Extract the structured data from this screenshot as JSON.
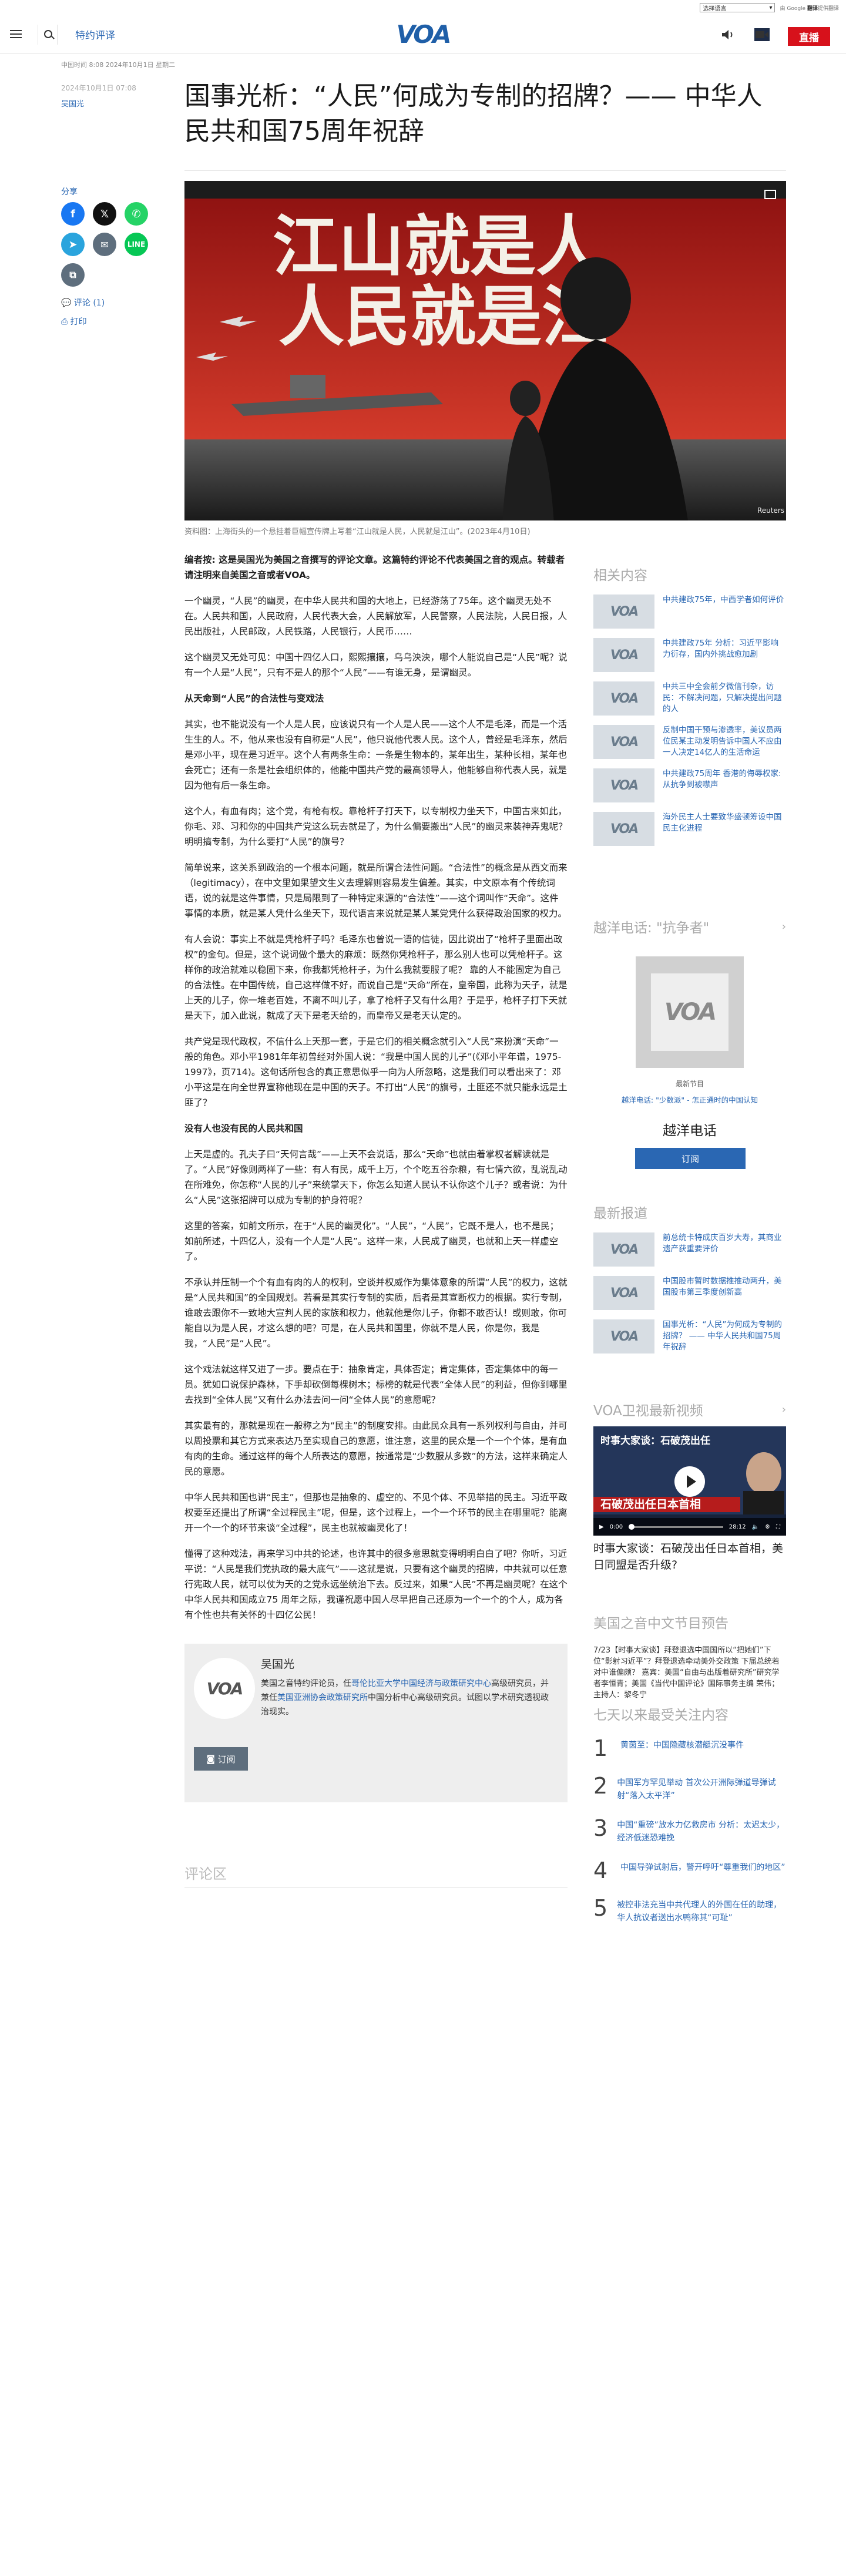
{
  "util": {
    "language_select": "选择语言",
    "powered": "由 Google",
    "translate_label": "翻译",
    "translate_extra": "提供翻译"
  },
  "header": {
    "section": "特约评译",
    "logo": "VOA",
    "live": "直播"
  },
  "article": {
    "dateline": "中国时间 8:08 2024年10月1日 星期二",
    "date": "2024年10月1日 07:08",
    "author": "吴国光",
    "title": "国事光析：“人民”何成为专制的招牌？—— 中华人民共和国75周年祝辞",
    "hero_banner_1": "江山就是人",
    "hero_banner_2": "人民就是江",
    "hero_credit": "Reuters",
    "caption": "资料图：上海街头的一个悬挂着巨幅宣传牌上写着“江山就是人民，人民就是江山”。(2023年4月10日)",
    "paragraphs": [
      {
        "type": "lead",
        "text": "编者按: 这是吴国光为美国之音撰写的评论文章。这篇特约评论不代表美国之音的观点。转载者请注明来自美国之音或者VOA。"
      },
      {
        "type": "p",
        "text": "一个幽灵，“人民”的幽灵，在中华人民共和国的大地上，已经游荡了75年。这个幽灵无处不在。人民共和国，人民政府，人民代表大会，人民解放军，人民警察，人民法院，人民日报，人民出版社，人民邮政，人民铁路，人民银行，人民币……"
      },
      {
        "type": "p",
        "text": "这个幽灵又无处可见：中国十四亿人口，熙熙攘攘，乌乌泱泱，哪个人能说自己是“人民”呢？说有一个人是“人民”，只有不是人的那个“人民”——有谁无身，是谓幽灵。"
      },
      {
        "type": "sub",
        "text": "从天命到“人民”的合法性与变戏法"
      },
      {
        "type": "p",
        "text": "其实，也不能说没有一个人是人民，应该说只有一个人是人民——这个人不是毛泽，而是一个活生生的人。不，他从来也没有自称是“人民”，他只说他代表人民。这个人，曾经是毛泽东，然后是邓小平，现在是习近平。这个人有两条生命：一条是生物本的，某年出生，某种长相，某年也会死亡；还有一条是社会组织体的，他能中国共产党的最高领导人，他能够自称代表人民，就是因为他有后一条生命。"
      },
      {
        "type": "p",
        "text": "这个人，有血有肉；这个党，有枪有权。靠枪杆子打天下，以专制权力坐天下，中国古来如此，你毛、邓、习和你的中国共产党这么玩去就是了，为什么偏要搬出“人民”的幽灵来装神弄鬼呢？明明搞专制，为什么要打“人民”的旗号？"
      },
      {
        "type": "p",
        "text": "简单说来，这关系到政治的一个根本问题，就是所谓合法性问题。“合法性”的概念是从西文而来（legitimacy），在中文里如果望文生义去理解则容易发生偏差。其实，中文原本有个传统词语，说的就是这件事情，只是局限到了一种特定来源的“合法性”——这个词叫作“天命”。这件事情的本质，就是某人凭什么坐天下，现代语言来说就是某人某党凭什么获得政治国家的权力。"
      },
      {
        "type": "p",
        "text": "有人会说：事实上不就是凭枪杆子吗？毛泽东也曾说一语的信徒，因此说出了“枪杆子里面出政权”的金句。但是，这个说词做个最大的麻烦：既然你凭枪杆子，那么别人也可以凭枪杆子。这样你的政治就难以稳固下来，你我都凭枪杆子，为什么我就要服了呢？ 靠的人不能固定为自己的合法性。在中国传统，自己这样做不好，而说自己是“天命”所在，皇帝国，此称为天子，就是上天的儿子，你一堆老百姓，不离不叫儿子，拿了枪杆子又有什么用？于是乎，枪杆子打下天就是天下，加入此说，就成了天下是老天给的，而皇帝又是老天认定的。"
      },
      {
        "type": "p",
        "text": "共产党是现代政权，不信什么上天那一套，于是它们的相关概念就引入“人民”来扮演“天命”一般的角色。邓小平1981年年初曾经对外国人说：“我是中国人民的儿子”(《邓小平年谱，1975-1997》，页714)。这句话所包含的真正意思似乎一向为人所忽略，这是我们可以看出来了：邓小平这是在向全世界宣称他现在是中国的天子。不打出“人民”的旗号，土匪还不就只能永远是土匪了？"
      },
      {
        "type": "sub",
        "text": "没有人也没有民的人民共和国"
      },
      {
        "type": "p",
        "text": "上天是虚的。孔夫子曰“天何言哉”——上天不会说话，那么“天命”也就由着掌权者解读就是了。“人民”好像则两样了一些：有人有民，成千上万，个个吃五谷杂粮，有七情六欲，乱说乱动在所难免，你怎称“人民的儿子”来统掌天下，你怎么知道人民认不认你这个儿子？或者说：为什么“人民”这张招牌可以成为专制的护身符呢？"
      },
      {
        "type": "p",
        "text": "这里的答案，如前文所示，在于“人民的幽灵化”。“人民”，“人民”，它既不是人，也不是民；如前所述，十四亿人，没有一个人是“人民”。这样一来，人民成了幽灵，也就和上天一样虚空了。"
      },
      {
        "type": "p",
        "text": "不承认并压制一个个有血有肉的人的权利，空谈并权威作为集体意象的所谓“人民”的权力，这就是“人民共和国”的全国规划。若看是其实行专制的实质，后者是其宣断权力的根据。实行专制，谁敢去跟你不一致地大宣判人民的家族和权力，他就他是你儿子，你都不敢否认！或则敢，你可能自以为是人民，才这么想的吧？可是，在人民共和国里，你就不是人民，你是你，我是我，“人民”是“人民”。"
      },
      {
        "type": "p",
        "text": "这个戏法就这样又进了一步。要点在于：抽象肯定，具体否定；肯定集体，否定集体中的每一员。犹如口说保护森林，下手却砍倒每棵树木；标榜的就是代表“全体人民”的利益，但你到哪里去找到“全体人民”又有什么办法去问一问“全体人民”的意愿呢？"
      },
      {
        "type": "p",
        "text": "其实最有的，那就是现在一般称之为“民主”的制度安排。由此民众具有一系列权利与自由，并可以周投票和其它方式来表达乃至实现自己的意愿，谁注意，这里的民众是一个一个个体，是有血有肉的生命。通过这样的每个人所表达的意愿，按通常是“少数服从多数”的方法，这样来确定人民的意愿。"
      },
      {
        "type": "p",
        "text": "中华人民共和国也讲“民主”，但那也是抽象的、虚空的、不见个体、不见举措的民主。习近平政权要至还提出了所谓“全过程民主”呢，但是，这个过程上，一个一个环节的民主在哪里呢？能离开一个一个的环节来谈“全过程”，民主也就被幽灵化了！"
      },
      {
        "type": "p",
        "text": "懂得了这种戏法，再来学习中共的论述，也许其中的很多意思就变得明明白白了吧？你听，习近平说：“人民是我们党执政的最大底气”——这就是说，只要有这个幽灵的招牌，中共就可以任意行宪政人民，就可以仗为天的之党永远坐统治下去。反过来，如果“人民”不再是幽灵呢？在这个中华人民共和国成立75 周年之际，我谨祝愿中国人尽早把自己还原为一个一个的个人，成为各有个性也共有关怀的十四亿公民！"
      }
    ],
    "comments_link": "评论 (1)",
    "print_link": "打印",
    "share_label": "分享"
  },
  "author_box": {
    "name": "吴国光",
    "bio_prefix": "美国之音特约评论员，任",
    "bio_link": "哥伦比亚大学中国经济与政策研究中心",
    "bio_mid": "高级研究员，并兼任",
    "bio_link2": "美国亚洲协会政策研究所",
    "bio_suffix": "中国分析中心高级研究员。试图以学术研究透视政治现实。",
    "subscribe": "订阅",
    "avatar": "VOA"
  },
  "comments": {
    "heading": "评论区"
  },
  "sidebar": {
    "related": {
      "heading": "相关内容",
      "items": [
        "中共建政75年，中西学者如何评价",
        "中共建政75年 分析：习近平影响力衍存，国内外挑战愈加剧",
        "中共三中全会前夕微信刊杂，访民：不解决问题，只解决提出问题的人",
        "反制中国干预与渗透率，美议员两位民某主动发明告诉中国人不应由一人决定14亿人的生活命运",
        "中共建政75周年 香港的侮辱权家:从抗争到被噤声",
        "海外民主人士要致华盛顿筹设中国民主化进程"
      ]
    },
    "radio": {
      "heading": "越洋电话: \"抗争者\"",
      "sub": "最新节目",
      "desc": "越洋电话: \"少数派\" - 怎正通时的中国认知",
      "name": "越洋电话",
      "subscribe": "订阅"
    },
    "latest": {
      "heading": "最新报道",
      "items": [
        "前总统卡特成庆百岁大寿，其商业遗产获重要评价",
        "中国股市暂时数据推推动两升，美国股市第三季度创新高",
        "国事光析：“人民”为何成为专制的招牌？ —— 中华人民共和国75周年祝辞"
      ]
    },
    "video": {
      "heading": "VOA卫视最新视频",
      "overlay_title": "时事大家谈：石破茂出任",
      "overlay_caption": "石破茂出任日本首相",
      "time_cur": "0:00",
      "time_total": "28:12",
      "title_below": "时事大家谈：石破茂出任日本首相，美日同盟是否升级?"
    },
    "programs": {
      "heading": "美国之音中文节目预告",
      "text": "7/23【时事大家谈】拜登退选中国国所以“把她们”下位“影射习近平”？拜登退选牵动美外交政策 下届总统若对中谁偏颇？ 嘉宾：美国“自由与出版着研究所”研究学者李恒青；美国《当代中国评论》国际事务主编 荣伟；主持人：黎冬宁"
    },
    "most_read": {
      "heading": "七天以来最受关注内容",
      "items": [
        {
          "num": "1",
          "text": "黄茵至：中国隐藏核潜艇沉没事件"
        },
        {
          "num": "2",
          "text": "中国军方罕见举动 首次公开洲际弹道导弹试射“落入太平洋”"
        },
        {
          "num": "3",
          "text": "中国“重磅”放水力亿救房市 分析：太迟太少，经济低迷恐难挽"
        },
        {
          "num": "4",
          "text": "中国导弹试射后，警开呼吁“尊重我们的地区”"
        },
        {
          "num": "5",
          "text": "被控非法充当中共代理人的外国在任的助理，华人抗议者送出水鸭称其“可耻”"
        }
      ]
    }
  },
  "colors": {
    "brand": "#1f5fa8",
    "live": "#d7111b",
    "link": "#2a67b3"
  }
}
